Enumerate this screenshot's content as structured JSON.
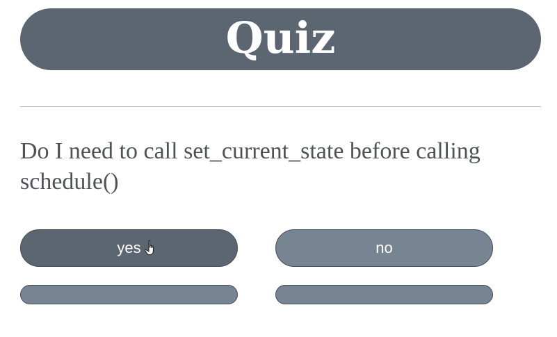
{
  "header": {
    "title": "Quiz"
  },
  "question": {
    "text": "Do I need to call set_current_state before calling schedule()"
  },
  "answers": [
    {
      "label": "yes",
      "state": "hover"
    },
    {
      "label": "no",
      "state": "default"
    }
  ],
  "cursor": {
    "icon": "hand-pointer-icon"
  },
  "colors": {
    "banner": "#5c6670",
    "button_hover": "#5c6670",
    "button": "#778491",
    "button_text": "#ffffff",
    "question_text": "#4f5358",
    "divider": "#b9b9b9"
  }
}
